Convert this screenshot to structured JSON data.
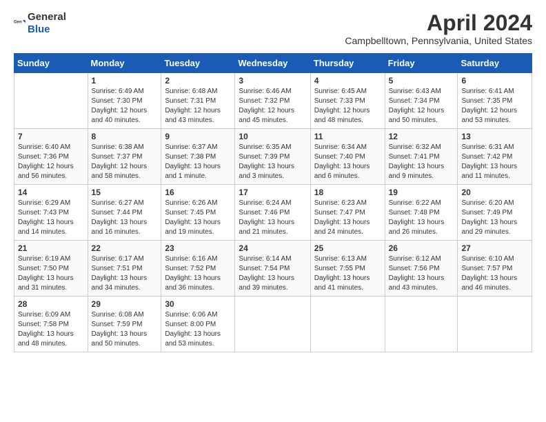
{
  "header": {
    "logo_general": "General",
    "logo_blue": "Blue",
    "month": "April 2024",
    "location": "Campbelltown, Pennsylvania, United States"
  },
  "weekdays": [
    "Sunday",
    "Monday",
    "Tuesday",
    "Wednesday",
    "Thursday",
    "Friday",
    "Saturday"
  ],
  "weeks": [
    [
      {
        "day": "",
        "info": ""
      },
      {
        "day": "1",
        "info": "Sunrise: 6:49 AM\nSunset: 7:30 PM\nDaylight: 12 hours\nand 40 minutes."
      },
      {
        "day": "2",
        "info": "Sunrise: 6:48 AM\nSunset: 7:31 PM\nDaylight: 12 hours\nand 43 minutes."
      },
      {
        "day": "3",
        "info": "Sunrise: 6:46 AM\nSunset: 7:32 PM\nDaylight: 12 hours\nand 45 minutes."
      },
      {
        "day": "4",
        "info": "Sunrise: 6:45 AM\nSunset: 7:33 PM\nDaylight: 12 hours\nand 48 minutes."
      },
      {
        "day": "5",
        "info": "Sunrise: 6:43 AM\nSunset: 7:34 PM\nDaylight: 12 hours\nand 50 minutes."
      },
      {
        "day": "6",
        "info": "Sunrise: 6:41 AM\nSunset: 7:35 PM\nDaylight: 12 hours\nand 53 minutes."
      }
    ],
    [
      {
        "day": "7",
        "info": "Sunrise: 6:40 AM\nSunset: 7:36 PM\nDaylight: 12 hours\nand 56 minutes."
      },
      {
        "day": "8",
        "info": "Sunrise: 6:38 AM\nSunset: 7:37 PM\nDaylight: 12 hours\nand 58 minutes."
      },
      {
        "day": "9",
        "info": "Sunrise: 6:37 AM\nSunset: 7:38 PM\nDaylight: 13 hours\nand 1 minute."
      },
      {
        "day": "10",
        "info": "Sunrise: 6:35 AM\nSunset: 7:39 PM\nDaylight: 13 hours\nand 3 minutes."
      },
      {
        "day": "11",
        "info": "Sunrise: 6:34 AM\nSunset: 7:40 PM\nDaylight: 13 hours\nand 6 minutes."
      },
      {
        "day": "12",
        "info": "Sunrise: 6:32 AM\nSunset: 7:41 PM\nDaylight: 13 hours\nand 9 minutes."
      },
      {
        "day": "13",
        "info": "Sunrise: 6:31 AM\nSunset: 7:42 PM\nDaylight: 13 hours\nand 11 minutes."
      }
    ],
    [
      {
        "day": "14",
        "info": "Sunrise: 6:29 AM\nSunset: 7:43 PM\nDaylight: 13 hours\nand 14 minutes."
      },
      {
        "day": "15",
        "info": "Sunrise: 6:27 AM\nSunset: 7:44 PM\nDaylight: 13 hours\nand 16 minutes."
      },
      {
        "day": "16",
        "info": "Sunrise: 6:26 AM\nSunset: 7:45 PM\nDaylight: 13 hours\nand 19 minutes."
      },
      {
        "day": "17",
        "info": "Sunrise: 6:24 AM\nSunset: 7:46 PM\nDaylight: 13 hours\nand 21 minutes."
      },
      {
        "day": "18",
        "info": "Sunrise: 6:23 AM\nSunset: 7:47 PM\nDaylight: 13 hours\nand 24 minutes."
      },
      {
        "day": "19",
        "info": "Sunrise: 6:22 AM\nSunset: 7:48 PM\nDaylight: 13 hours\nand 26 minutes."
      },
      {
        "day": "20",
        "info": "Sunrise: 6:20 AM\nSunset: 7:49 PM\nDaylight: 13 hours\nand 29 minutes."
      }
    ],
    [
      {
        "day": "21",
        "info": "Sunrise: 6:19 AM\nSunset: 7:50 PM\nDaylight: 13 hours\nand 31 minutes."
      },
      {
        "day": "22",
        "info": "Sunrise: 6:17 AM\nSunset: 7:51 PM\nDaylight: 13 hours\nand 34 minutes."
      },
      {
        "day": "23",
        "info": "Sunrise: 6:16 AM\nSunset: 7:52 PM\nDaylight: 13 hours\nand 36 minutes."
      },
      {
        "day": "24",
        "info": "Sunrise: 6:14 AM\nSunset: 7:54 PM\nDaylight: 13 hours\nand 39 minutes."
      },
      {
        "day": "25",
        "info": "Sunrise: 6:13 AM\nSunset: 7:55 PM\nDaylight: 13 hours\nand 41 minutes."
      },
      {
        "day": "26",
        "info": "Sunrise: 6:12 AM\nSunset: 7:56 PM\nDaylight: 13 hours\nand 43 minutes."
      },
      {
        "day": "27",
        "info": "Sunrise: 6:10 AM\nSunset: 7:57 PM\nDaylight: 13 hours\nand 46 minutes."
      }
    ],
    [
      {
        "day": "28",
        "info": "Sunrise: 6:09 AM\nSunset: 7:58 PM\nDaylight: 13 hours\nand 48 minutes."
      },
      {
        "day": "29",
        "info": "Sunrise: 6:08 AM\nSunset: 7:59 PM\nDaylight: 13 hours\nand 50 minutes."
      },
      {
        "day": "30",
        "info": "Sunrise: 6:06 AM\nSunset: 8:00 PM\nDaylight: 13 hours\nand 53 minutes."
      },
      {
        "day": "",
        "info": ""
      },
      {
        "day": "",
        "info": ""
      },
      {
        "day": "",
        "info": ""
      },
      {
        "day": "",
        "info": ""
      }
    ]
  ]
}
